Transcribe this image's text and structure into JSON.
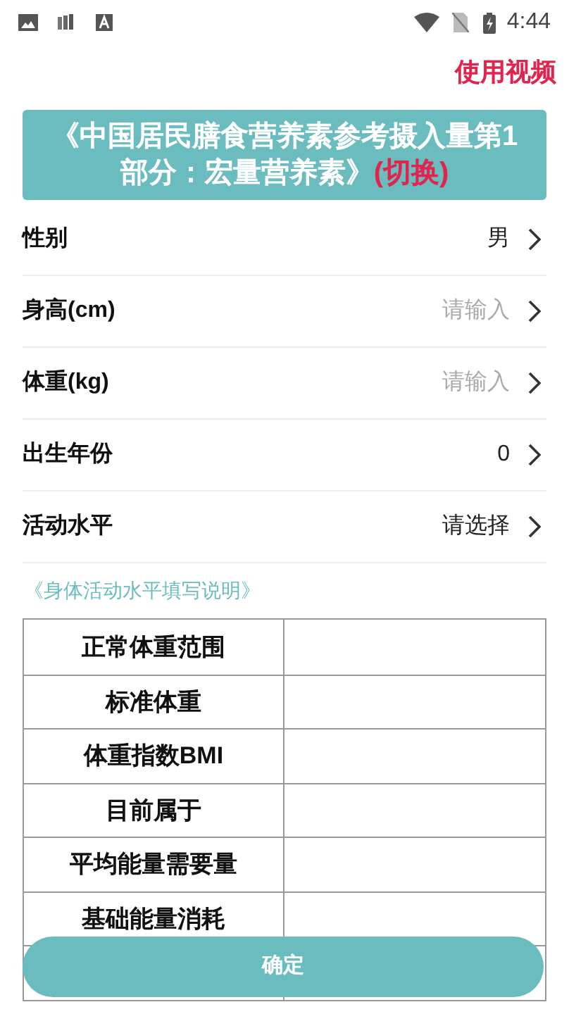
{
  "status_bar": {
    "time": "4:44"
  },
  "header": {
    "video_link": "使用视频"
  },
  "banner": {
    "title": "《中国居民膳食营养素参考摄入量第1部分：宏量营养素》",
    "switch": "(切换)"
  },
  "form": [
    {
      "label": "性别",
      "kind": "select",
      "value": "男"
    },
    {
      "label": "身高(cm)",
      "kind": "input",
      "placeholder": "请输入"
    },
    {
      "label": "体重(kg)",
      "kind": "input",
      "placeholder": "请输入"
    },
    {
      "label": "出生年份",
      "kind": "select",
      "value": "0"
    },
    {
      "label": "活动水平",
      "kind": "select",
      "value": "请选择"
    }
  ],
  "help_link": "《身体活动水平填写说明》",
  "results": [
    {
      "label": "正常体重范围"
    },
    {
      "label": "标准体重"
    },
    {
      "label": "体重指数BMI"
    },
    {
      "label": "目前属于"
    },
    {
      "label": "平均能量需要量"
    },
    {
      "label": "基础能量消耗"
    }
  ],
  "confirm_button": "确定"
}
